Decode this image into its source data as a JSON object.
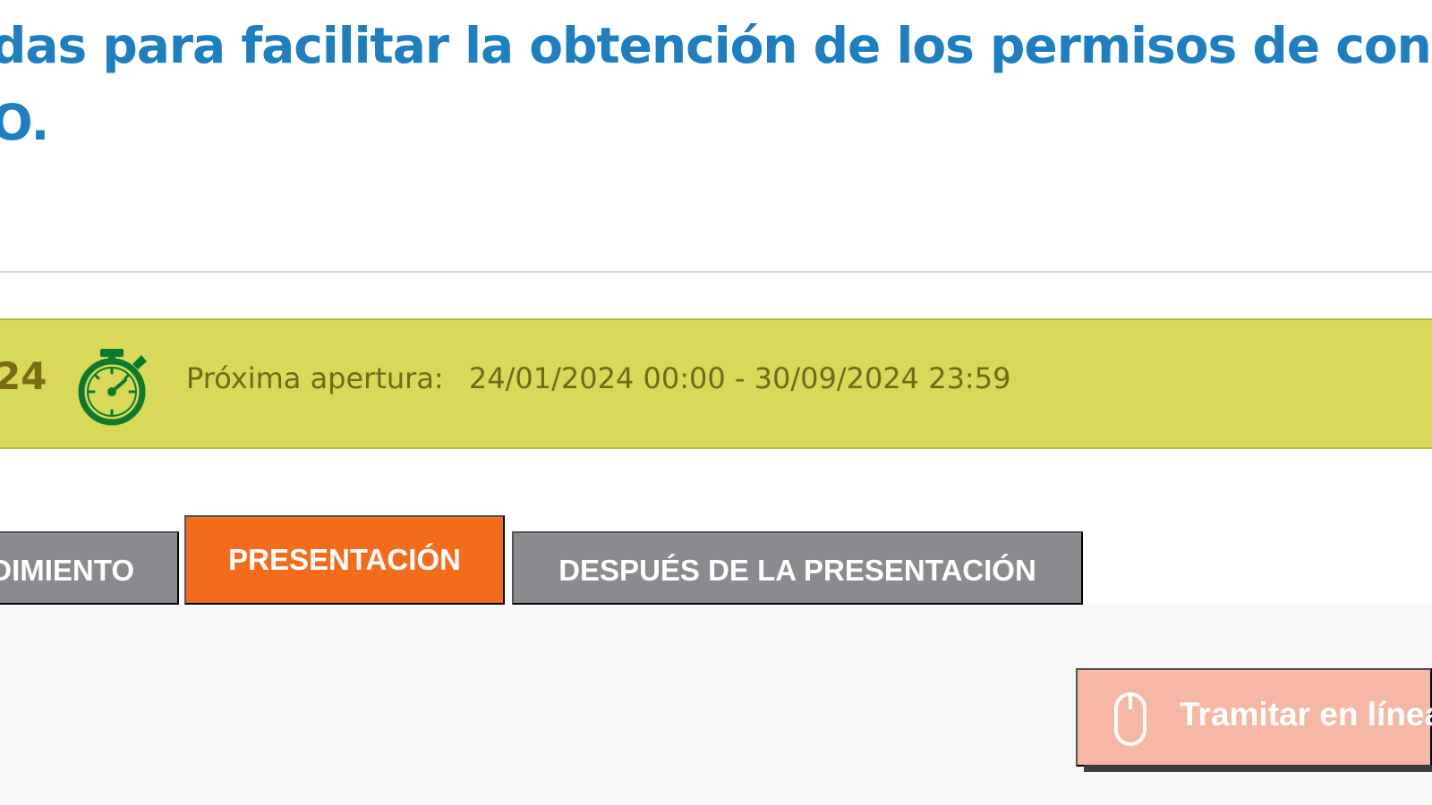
{
  "page": {
    "title_line_1": "das para facilitar la obtención de los permisos de conduc",
    "title_line_2": "O."
  },
  "status": {
    "previous_fragment": "24",
    "label": "Próxima apertura:",
    "date_range": "24/01/2024 00:00 - 30/09/2024 23:59",
    "icon": "stopwatch-icon",
    "bar_color": "#d8d859",
    "icon_color": "#0d7a2b"
  },
  "tabs": [
    {
      "label": "DIMIENTO",
      "active": false
    },
    {
      "label": "PRESENTACIÓN",
      "active": true
    },
    {
      "label": "DESPUÉS DE LA PRESENTACIÓN",
      "active": false
    }
  ],
  "actions": {
    "online_label": "Tramitar en línea",
    "online_icon": "mouse-icon",
    "online_color": "#f6b8a5"
  },
  "colors": {
    "title": "#1d7fc0",
    "tab_inactive": "#8b8b8f",
    "tab_active": "#f36c1b",
    "panel": "#f8f8f8"
  }
}
